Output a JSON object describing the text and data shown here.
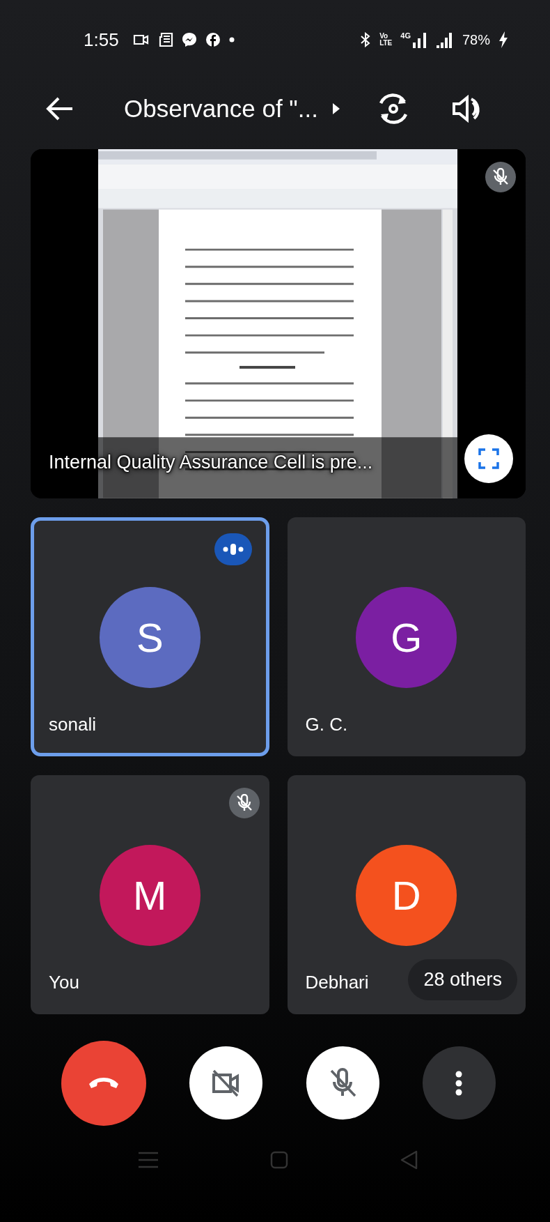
{
  "status_bar": {
    "time": "1:55",
    "volte": [
      "Vo",
      "LTE"
    ],
    "network": "4G",
    "battery": "78%"
  },
  "header": {
    "title": "Observance of \"..."
  },
  "presentation": {
    "kind": "picture",
    "caption": "Internal Quality Assurance Cell is pre...",
    "muted": true
  },
  "participants": [
    {
      "name": "sonali",
      "initial": "S",
      "color": "#5c6bc0",
      "speaking": true,
      "muted": false
    },
    {
      "name": "G. C.",
      "initial": "G",
      "color": "#7b1fa2",
      "speaking": false,
      "muted": false
    },
    {
      "name": "You",
      "initial": "M",
      "color": "#c2185b",
      "speaking": false,
      "muted": true
    },
    {
      "name": "Debhari",
      "initial": "D",
      "color": "#f4511e",
      "speaking": false,
      "muted": false
    }
  ],
  "others": "28 others",
  "controls": [
    {
      "kind": "hangup"
    },
    {
      "kind": "camera",
      "on": false
    },
    {
      "kind": "mic",
      "on": false
    },
    {
      "kind": "more"
    }
  ]
}
